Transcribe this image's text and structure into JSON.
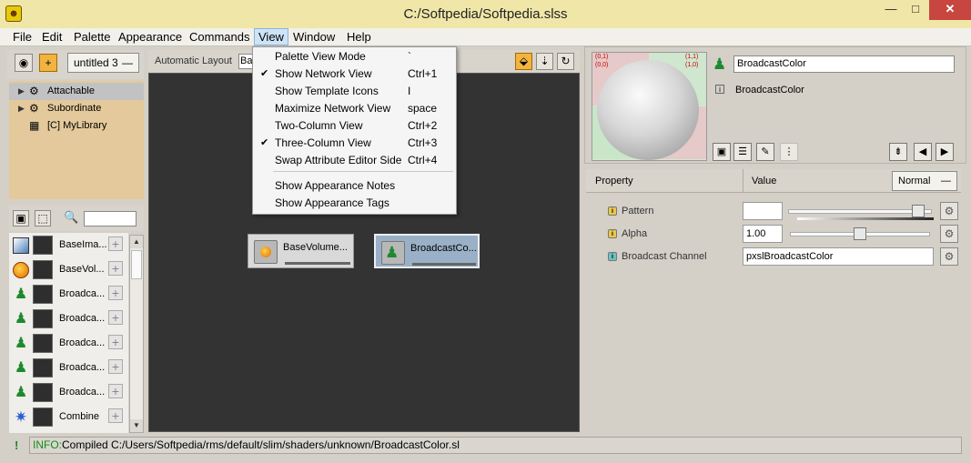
{
  "window": {
    "title": "C:/Softpedia/Softpedia.slss",
    "controls": {
      "minimize": "—",
      "maximize": "□",
      "close": "✕"
    }
  },
  "menubar": {
    "items": [
      "File",
      "Edit",
      "Palette",
      "Appearance",
      "Commands",
      "View",
      "Window",
      "Help"
    ],
    "active": "View"
  },
  "view_menu": {
    "items": [
      {
        "label": "Palette View Mode",
        "accel": "`",
        "checked": false
      },
      {
        "label": "Show Network View",
        "accel": "Ctrl+1",
        "checked": true
      },
      {
        "label": "Show Template Icons",
        "accel": "I",
        "checked": false
      },
      {
        "label": "Maximize Network View",
        "accel": "space",
        "checked": false
      },
      {
        "label": "Two-Column View",
        "accel": "Ctrl+2",
        "checked": false
      },
      {
        "label": "Three-Column View",
        "accel": "Ctrl+3",
        "checked": true
      },
      {
        "label": "Swap Attribute Editor Side",
        "accel": "Ctrl+4",
        "checked": false
      },
      {
        "label": "Show Appearance Notes",
        "accel": "",
        "checked": false
      },
      {
        "label": "Show Appearance Tags",
        "accel": "",
        "checked": false
      }
    ],
    "check_glyph": "✔"
  },
  "left_panel": {
    "dropdown": "untitled 3",
    "tree": [
      {
        "label": "Attachable",
        "expandable": true,
        "selected": true
      },
      {
        "label": "Subordinate",
        "expandable": true,
        "selected": false
      },
      {
        "label": "[C] MyLibrary",
        "expandable": false,
        "selected": false
      }
    ],
    "palette": [
      {
        "label": "BaseIma...",
        "icon": "image-icon"
      },
      {
        "label": "BaseVol...",
        "icon": "volume-icon"
      },
      {
        "label": "Broadca...",
        "icon": "broadcast-icon"
      },
      {
        "label": "Broadca...",
        "icon": "broadcast-icon"
      },
      {
        "label": "Broadca...",
        "icon": "broadcast-icon"
      },
      {
        "label": "Broadca...",
        "icon": "broadcast-icon"
      },
      {
        "label": "Broadca...",
        "icon": "broadcast-icon"
      },
      {
        "label": "Combine",
        "icon": "combine-icon"
      }
    ],
    "plus_glyph": "+"
  },
  "network": {
    "toolbar_label": "Automatic Layout",
    "layout_value": "Ba",
    "nodes": [
      {
        "label": "BaseVolume...",
        "icon": "volume-icon",
        "selected": false
      },
      {
        "label": "BroadcastCo...",
        "icon": "broadcast-icon",
        "selected": true
      }
    ]
  },
  "inspector": {
    "name": "BroadcastColor",
    "type_label": "BroadcastColor",
    "preview_coords": [
      "(0,1)",
      "(1,1)",
      "(0,0)",
      "(1,0)"
    ],
    "header": {
      "property": "Property",
      "value": "Value",
      "mode": "Normal"
    },
    "properties": [
      {
        "label": "Pattern",
        "badge": "i",
        "badge_color": "#e8c84a",
        "value": "",
        "has_slider": true,
        "slider_pos": 0.95
      },
      {
        "label": "Alpha",
        "badge": "i",
        "badge_color": "#e8c84a",
        "value": "1.00",
        "has_slider": true,
        "slider_pos": 0.5
      },
      {
        "label": "Broadcast Channel",
        "badge": "i",
        "badge_color": "#6bc3c3",
        "value": "pxslBroadcastColor",
        "has_slider": false
      }
    ]
  },
  "status": {
    "prefix": "INFO:",
    "text": "Compiled C:/Users/Softpedia/rms/default/slim/shaders/unknown/BroadcastColor.sl",
    "icon": "!"
  }
}
